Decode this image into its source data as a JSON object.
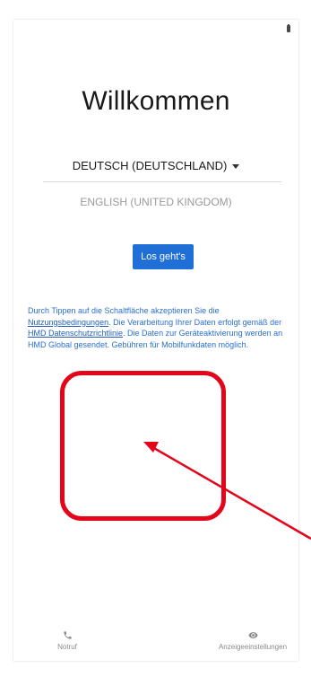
{
  "welcome": {
    "title": "Willkommen",
    "language_selected": "DEUTSCH (DEUTSCHLAND)",
    "language_other": "ENGLISH (UNITED KINGDOM)",
    "start_button": "Los geht's"
  },
  "consent": {
    "text_1": "Durch Tippen auf die Schaltfläche akzeptieren Sie die ",
    "link_terms": "Nutzungsbedingungen",
    "text_2": ". Die Verarbeitung Ihrer Daten erfolgt gemäß der ",
    "link_privacy": "HMD Datenschutzrichtlinie",
    "text_3": ". Die Daten zur Geräteaktivierung werden an HMD Global gesendet. Gebühren für Mobilfunkdaten möglich."
  },
  "bottom_nav": {
    "emergency_label": "Notruf",
    "display_label": "Anzeigeeinstellungen"
  },
  "icons": {
    "emergency": "phone-icon",
    "display": "eye-icon"
  },
  "colors": {
    "accent": "#1f6fd6",
    "annotation": "#e3061b",
    "link": "#2a6fd0"
  }
}
